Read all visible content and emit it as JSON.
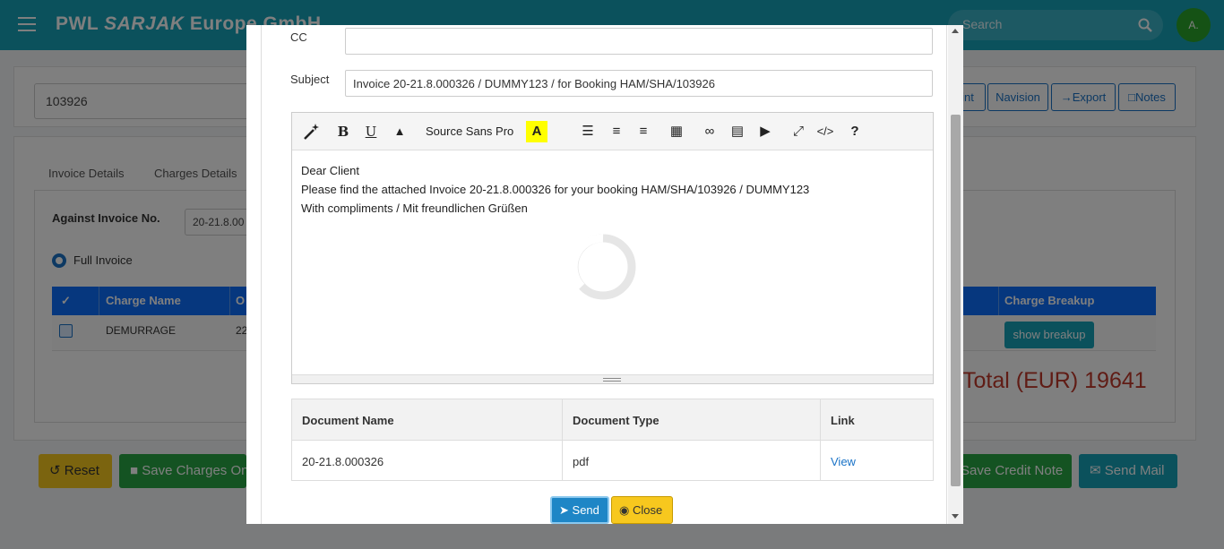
{
  "app": {
    "brand_prefix": "PWL ",
    "brand_bold": "SARJAK",
    "brand_suffix": " Europe GmbH",
    "search_placeholder": "Search",
    "avatar_initial": "A."
  },
  "booking": {
    "number": "103926"
  },
  "toolbar": {
    "print_label": "int",
    "navision_label": "Navision",
    "export_label": "Export",
    "notes_label": "Notes"
  },
  "tabs": [
    "Invoice Details",
    "Charges Details"
  ],
  "form": {
    "against_invoice_label": "Against Invoice No.",
    "against_invoice_value": "20-21.8.00",
    "full_invoice_label": "Full Invoice"
  },
  "charges_table": {
    "headers": [
      "Charge Name",
      "O",
      "Charge Breakup"
    ],
    "rows": [
      {
        "charge_name": "DEMURRAGE",
        "col2": "22",
        "breakup_button": "show breakup"
      }
    ]
  },
  "grand_total": "Total (EUR) 19641",
  "actions": {
    "reset": "Reset",
    "save_charges": "Save Charges On",
    "save_credit_note": "Save Credit Note",
    "send_mail": "Send Mail"
  },
  "modal": {
    "cc_label": "CC",
    "cc_value": "",
    "subject_label": "Subject",
    "subject_value": "Invoice 20-21.8.000326 / DUMMY123 / for Booking HAM/SHA/103926",
    "editor": {
      "font_name": "Source Sans Pro",
      "tools": [
        "magic-wand",
        "bold",
        "underline",
        "eraser",
        "font",
        "font-color",
        "unordered-list",
        "ordered-list",
        "align",
        "table",
        "link",
        "image",
        "video",
        "fullscreen",
        "code-view",
        "help"
      ],
      "lines": [
        "Dear Client",
        "Please find the attached Invoice 20-21.8.000326 for your booking HAM/SHA/103926 / DUMMY123",
        "With compliments / Mit freundlichen Grüßen"
      ]
    },
    "documents": {
      "headers": [
        "Document Name",
        "Document Type",
        "Link"
      ],
      "rows": [
        {
          "name": "20-21.8.000326",
          "type": "pdf",
          "link": "View"
        }
      ]
    },
    "send_label": "Send",
    "close_label": "Close"
  },
  "colors": {
    "topbar": "#17a2b8",
    "primary": "#0d6efd",
    "reset": "#f7c81e",
    "save_charges": "#28a745",
    "send_mail": "#17a2b8",
    "total": "#c0392b"
  }
}
